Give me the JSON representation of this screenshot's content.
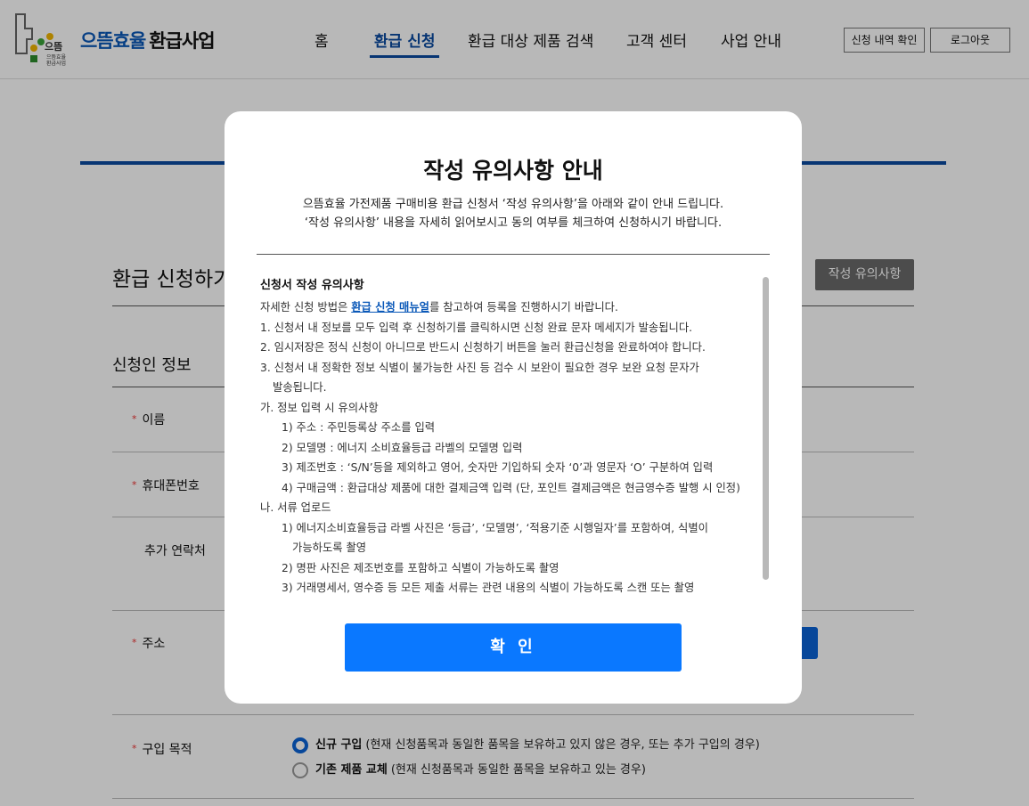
{
  "header": {
    "brand_accent": "으뜸효율",
    "brand_main": "환급사업",
    "logo_text": "으뜸효율 환급사업",
    "nav": [
      {
        "label": "홈"
      },
      {
        "label": "환급 신청"
      },
      {
        "label": "환급 대상 제품 검색"
      },
      {
        "label": "고객 센터"
      },
      {
        "label": "사업 안내"
      }
    ],
    "active_nav": "환급 신청",
    "history_button": "신청 내역 확인",
    "logout_button": "로그아웃"
  },
  "page": {
    "section_title": "환급 신청하기",
    "guide_button": "작성 유의사항",
    "applicant_title": "신청인 정보",
    "fields": {
      "name": "이름",
      "phone": "휴대폰번호",
      "extra_contact": "추가 연락처",
      "address": "주소",
      "purpose": "구입 목적"
    },
    "purpose_options": [
      {
        "label": "신규 구입",
        "desc": "(현재 신청품목과 동일한 품목을 보유하고 있지 않은 경우, 또는 추가 구입의 경우)",
        "selected": true
      },
      {
        "label": "기존 제품 교체",
        "desc": "(현재 신청품목과 동일한 품목을 보유하고 있는 경우)",
        "selected": false
      }
    ]
  },
  "modal": {
    "title": "작성 유의사항 안내",
    "desc_line1": "으뜸효율 가전제품 구매비용 환급 신청서 ‘작성 유의사항’을 아래와 같이 안내 드립니다.",
    "desc_line2": "‘작성 유의사항’ 내용을 자세히 읽어보시고 동의 여부를 체크하여 신청하시기 바랍니다.",
    "body_heading": "신청서 작성 유의사항",
    "intro_prefix": "자세한 신청 방법은 ",
    "intro_link": "환급 신청 매뉴얼",
    "intro_suffix": "를 참고하여 등록을 진행하시기 바랍니다.",
    "item1": "1. 신청서 내 정보를 모두 입력 후 신청하기를 클릭하시면 신청 완료 문자 메세지가 발송됩니다.",
    "item2": "2. 임시저장은 정식 신청이 아니므로 반드시 신청하기 버튼을 눌러 환급신청을 완료하여야 합니다.",
    "item3a": "3. 신청서 내 정확한 정보 식별이 불가능한 사진 등 검수 시 보완이 필요한 경우 보완 요청 문자가",
    "item3b": "발송됩니다.",
    "ga_title": "가. 정보 입력 시 유의사항",
    "ga1": "1) 주소 : 주민등록상 주소를 입력",
    "ga2": "2) 모델명 : 에너지 소비효율등급 라벨의 모델명 입력",
    "ga3": "3) 제조번호 : ‘S/N’등을 제외하고 영어, 숫자만 기입하되 숫자 ‘0’과 영문자 ‘O’ 구분하여 입력",
    "ga4": "4) 구매금액 : 환급대상 제품에 대한 결제금액 입력 (단, 포인트 결제금액은 현금영수증 발행 시 인정)",
    "na_title": "나. 서류 업로드",
    "na1a": "1) 에너지소비효율등급 라벨 사진은 ‘등급’, ‘모델명’, ‘적용기준 시행일자’를 포함하여, 식별이",
    "na1b": "가능하도록 촬영",
    "na2": "2) 명판 사진은 제조번호를 포함하고 식별이 가능하도록 촬영",
    "na3": "3) 거래명세서, 영수증 등 모든 제출 서류는 관련 내용의 식별이 가능하도록 스캔 또는 촬영",
    "confirm_button": "확 인"
  },
  "colors": {
    "accent": "#0a4aa0",
    "confirm": "#0a78ff",
    "dim_overlay": "rgba(0,0,0,0.28)"
  }
}
